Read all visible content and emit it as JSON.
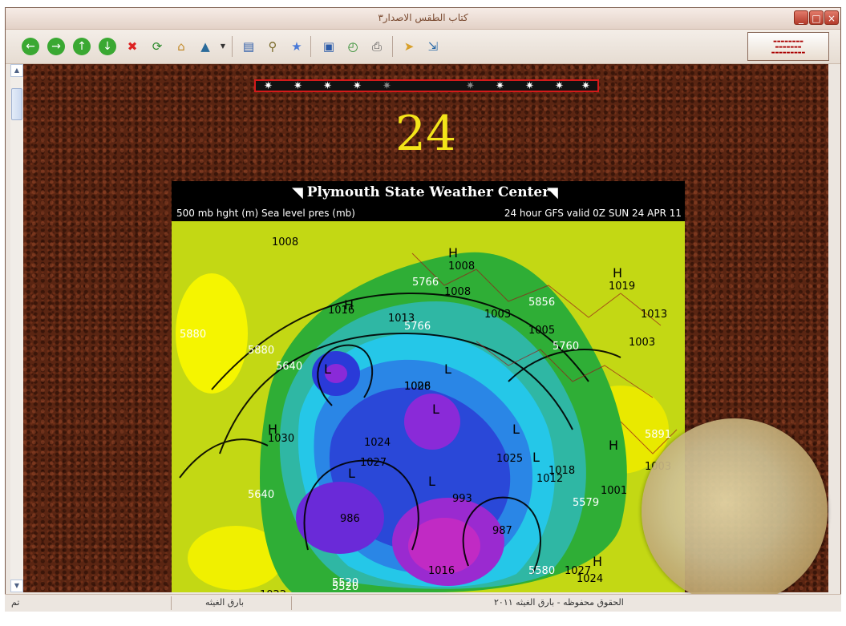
{
  "window": {
    "title": "كتاب الطقس الاصدار٣",
    "controls": {
      "minimize": "_",
      "maximize": "□",
      "close": "×"
    }
  },
  "toolbar": {
    "buttons": [
      {
        "name": "back",
        "icon": "left-arrow-icon"
      },
      {
        "name": "forward",
        "icon": "right-arrow-icon"
      },
      {
        "name": "up",
        "icon": "up-arrow-icon"
      },
      {
        "name": "down",
        "icon": "down-arrow-icon"
      },
      {
        "name": "stop",
        "icon": "stop-icon"
      },
      {
        "name": "refresh",
        "icon": "refresh-icon"
      },
      {
        "name": "home",
        "icon": "home-icon"
      },
      {
        "name": "sync",
        "icon": "sync-icon"
      },
      {
        "name": "toc",
        "icon": "contents-icon"
      },
      {
        "name": "search",
        "icon": "search-icon"
      },
      {
        "name": "favorites",
        "icon": "star-icon"
      },
      {
        "name": "options",
        "icon": "options-icon"
      },
      {
        "name": "history",
        "icon": "history-icon"
      },
      {
        "name": "print",
        "icon": "print-icon"
      },
      {
        "name": "pointer",
        "icon": "pointer-icon"
      },
      {
        "name": "export",
        "icon": "export-icon"
      }
    ],
    "logo_lines": [
      "▬▬▬▬▬▬▬▬",
      "▬▬▬▬▬▬▬",
      "▬▬▬▬▬▬▬▬▬"
    ]
  },
  "page": {
    "star_count": 11,
    "number": "24"
  },
  "map": {
    "header_title": "Plymouth State Weather Center",
    "left_subtitle": "500 mb hght (m) Sea level pres (mb)",
    "right_subtitle": "24 hour GFS valid 0Z SUN 24 APR 11",
    "labels": [
      "1008",
      "1006",
      "1008",
      "1008",
      "1013",
      "1016",
      "1003",
      "1005",
      "1003",
      "1019",
      "1013",
      "1003",
      "1001",
      "1030",
      "1024",
      "1027",
      "1025",
      "1018",
      "1012",
      "1022",
      "1024",
      "1027",
      "1028",
      "1016",
      "993",
      "987",
      "986",
      "5880",
      "5880",
      "5766",
      "5760",
      "5640",
      "5520",
      "5891",
      "5579",
      "5856",
      "5766",
      "5640",
      "5520",
      "5580",
      "H",
      "H",
      "H",
      "H",
      "H",
      "H",
      "L",
      "L",
      "L",
      "L",
      "L",
      "L",
      "L"
    ]
  },
  "status": {
    "left": "تم",
    "middle": "بارق الغيثه",
    "right": "الحقوق محفوظه - بارق الغيثه ٢٠١١"
  }
}
